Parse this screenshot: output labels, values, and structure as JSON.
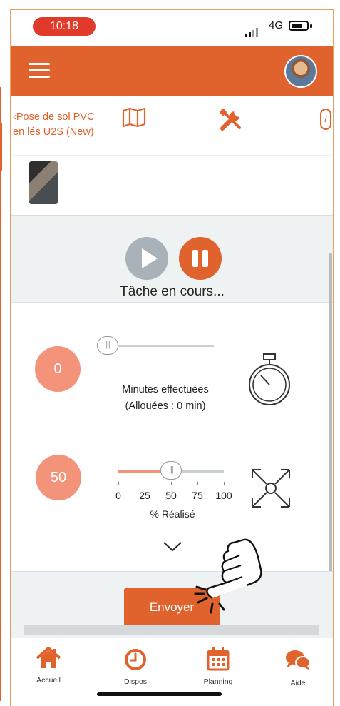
{
  "status_bar": {
    "time": "10:18",
    "network": "4G"
  },
  "header": {
    "menu_icon": "hamburger-icon",
    "avatar_icon": "user-avatar"
  },
  "toolbar": {
    "back_line1": "‹Pose de sol PVC",
    "back_line2": "en lés U2S (New)",
    "map_icon": "map-icon",
    "tools_icon": "tools-icon",
    "info_icon": "info-icon",
    "info_glyph": "i"
  },
  "player": {
    "status_text": "Tâche en cours..."
  },
  "minutes": {
    "value": "0",
    "label_line1": "Minutes effectuées",
    "label_line2": "(Allouées : 0 min)",
    "slider_fraction": 0
  },
  "progress": {
    "value": "50",
    "ticks": [
      "0",
      "25",
      "50",
      "75",
      "100"
    ],
    "label": "% Réalisé",
    "slider_percent": 50
  },
  "actions": {
    "send_label": "Envoyer"
  },
  "tabs": [
    {
      "label": "Accueil",
      "icon": "home-icon"
    },
    {
      "label": "Dispos",
      "icon": "clock-icon"
    },
    {
      "label": "Planning",
      "icon": "calendar-icon"
    },
    {
      "label": "Aide",
      "icon": "chat-bubbles-icon"
    }
  ],
  "colors": {
    "accent": "#e0622c",
    "badge": "#f2937a",
    "time_pill": "#e23a2a"
  }
}
